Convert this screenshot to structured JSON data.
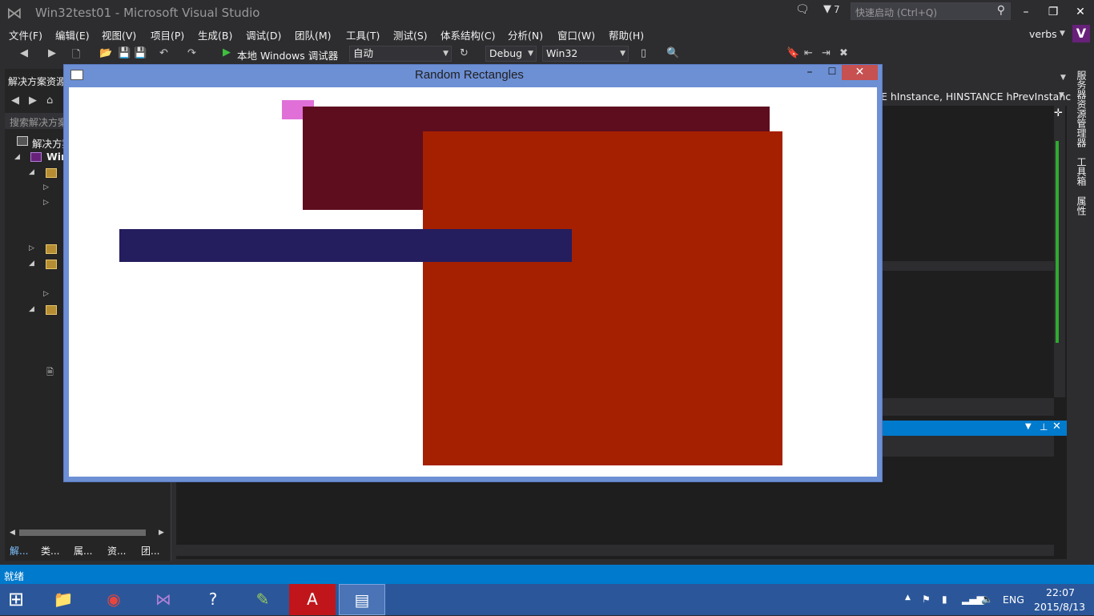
{
  "titlebar": {
    "title": "Win32test01 - Microsoft Visual Studio",
    "notification_count": "7",
    "quick_launch_placeholder": "快速启动 (Ctrl+Q)"
  },
  "menu": [
    "文件(F)",
    "编辑(E)",
    "视图(V)",
    "项目(P)",
    "生成(B)",
    "调试(D)",
    "团队(M)",
    "工具(T)",
    "测试(S)",
    "体系结构(C)",
    "分析(N)",
    "窗口(W)",
    "帮助(H)"
  ],
  "user": {
    "name": "verbs",
    "badge": "V"
  },
  "toolbar": {
    "run_label": "本地 Windows 调试器",
    "solution_config_auto": "自动",
    "configuration": "Debug",
    "platform": "Win32"
  },
  "solution_explorer": {
    "header": "解决方案资源",
    "search_placeholder": "搜索解决方案",
    "root_label": "解决方案",
    "project_label": "Wir",
    "bottom_tabs": [
      "解...",
      "类...",
      "属...",
      "资...",
      "团..."
    ]
  },
  "editor": {
    "signature_fragment": "E hInstance, HINSTANCE hPrevInstanc"
  },
  "right_tabs": [
    "服务器资源管理器",
    "工具箱",
    "属性"
  ],
  "app_window": {
    "title": "Random Rectangles",
    "rectangles": [
      {
        "color": "#e070d8"
      },
      {
        "color": "#5e0d1f"
      },
      {
        "color": "#a52000"
      },
      {
        "color": "#241d5e"
      }
    ]
  },
  "status": {
    "text": "就绪"
  },
  "taskbar": {
    "apps": [
      "file-explorer-icon",
      "chrome-icon",
      "visual-studio-icon",
      "help-icon",
      "notepad-plus-icon",
      "acrobat-icon",
      "app-window-icon"
    ],
    "language": "ENG",
    "time": "22:07",
    "date": "2015/8/13"
  },
  "colors": {
    "accent": "#007acc",
    "taskbar": "#2b579a",
    "window_frame": "#6d8fd4",
    "close_button": "#c75050"
  }
}
